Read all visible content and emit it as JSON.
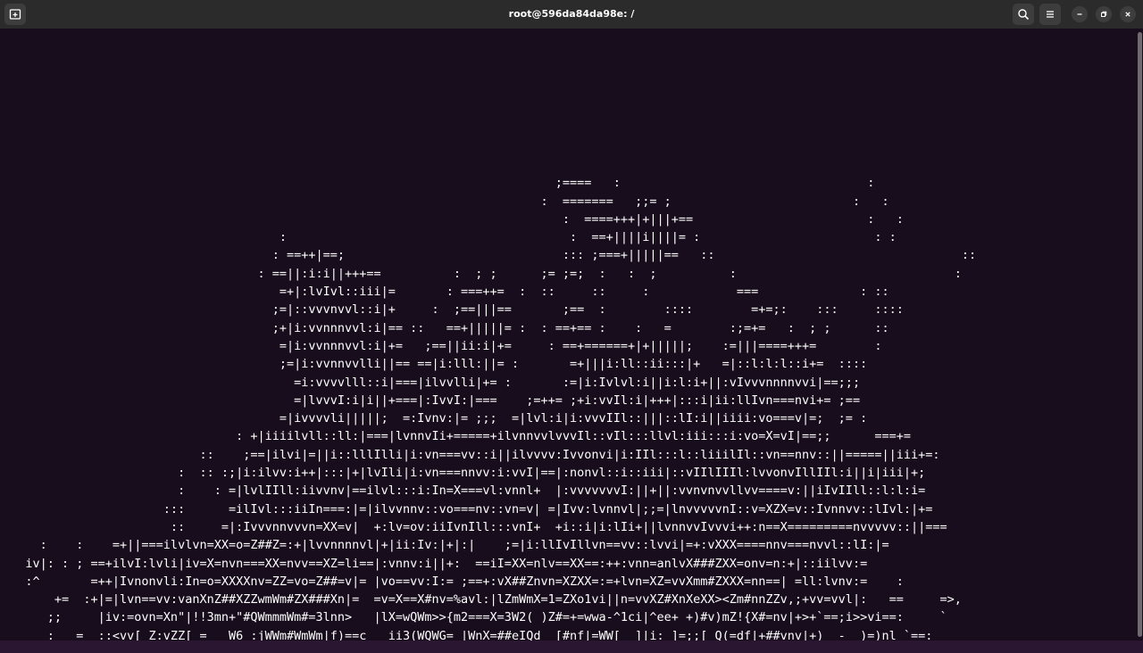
{
  "window": {
    "title": "root@596da84da98e: /",
    "icons": {
      "new_tab": "new-tab-icon",
      "search": "search-icon",
      "menu": "hamburger-menu-icon",
      "minimize": "minimize-icon",
      "restore": "restore-icon",
      "close": "close-icon"
    }
  },
  "colors": {
    "titlebar": "#2b2b2b",
    "terminal_bg": "#180d1d",
    "text": "#ffffff"
  },
  "terminal": {
    "lines": [
      "",
      "                                                                            ;====   :                                  :",
      "                                                                          :  =======   ;;= ;                         :   :",
      "                                                                             :  ====+++|+|||+==                        :   :",
      "                                      :                                       :  ==+||||i||||= :                        : :",
      "                                     : ==++|==;                              ::: ;===+|||||==   ::                                  ::",
      "                                   : ==||:i:i||+++==          :  ; ;      ;= ;=;  :   :  ;          :                              :",
      "                                      =+|:lvIvl::iii|=       : ===++=  :  ::     ::     :            ===              : ::",
      "                                     ;=|::vvvnvvl::i|+     :  ;==|||==       ;==  :        ::::        =+=;:    :::     ::::",
      "                                     ;+|i:vvnnnvvl:i|== ::   ==+|||||= :  : ==+== :    :   =        :;=+=   :  ; ;      ::",
      "                                      =|i:vvnnnvvl:i|+=   ;==||ii:i|+=     : ==+======+|+|||||;    :=|||====+++=        :",
      "                                      ;=|i:vvnnvvlli||== ==|i:lll:||= :       =+|||i:ll::ii:::|+   =|::l:l:l::i+=  ::::",
      "                                        =i:vvvvlll::i|===|ilvvlli|+= :       :=|i:Ivlvl:i||i:l:i+||:vIvvvnnnnvvi|==;;;",
      "                                        =|lvvvI:i|i||+===|:IvvI:|===    ;=++= ;+i:vvIl:i|+++|:::i|ii:llIvn===nvi+= ;==",
      "                                      =|ivvvvli|||||;  =:Ivnv:|= ;;;  =|lvl:i|i:vvvIIl::|||::lI:i||iiii:vo===v|=;  ;= :",
      "                                : +|iiiilvll::ll:|===|lvnnvIi+=====+ilvnnvvlvvvIl::vIl:::llvl:iii:::i:vo=X=vI|==;;      ===+=",
      "                           ::    ;==|ilvi|=||i::lllIlli|i:vn===vv::i||ilvvvv:Ivvonvi|i:IIl:::l::liiilIl::vn==nnv::||=====||iii+=:",
      "                        :  :: :;|i:ilvv:i++|:::|+|lvIli|i:vn===nnvv:i:vvI|==|:nonvl::i::iii|::vIIlIIIl:lvvonvIllIIl:i||i|iii|+;",
      "                        :    : =|lvlIIll:iivvnv|==ilvl:::i:In=X===vl:vnnl+  |:vvvvvvvI:||+||:vvnvnvvllvv====v:||iIvIIll::l:l:i=",
      "                      :::      =ilIvl:::iiIn===:|=|ilvvnnv::vo===nv::vn=v| =|Ivv:lvnnvl|;;=|lnvvvvvnI::v=XZX=v::Ivnnvv::lIvl:|+=",
      "                       ::     =|:Ivvvnnvvvn=XX=v|  +:lv=ov:iiIvnIll:::vnI+  +i::i|i:lIi+||lvnnvvIvvvi++:n==X=========nvvvvv::||===",
      "     :    :    =+||===ilvlvn=XX=o=Z##Z=:+|lvvnnnnvl|+|ii:Iv:|+|:|    ;=|i:llIvIllvn==vv::lvvi|=+:vXXX====nnv===nvvl::lI:|=",
      "   iv|: : ; ==+ilvI:lvli|iv=X=nvn===XX=nvv==XZ=li==|:vnnv:i||+:  ==iI=XX=nlv==XX==:++:vnn=anlvX###ZXX=onv=n:+|::iilvv:=",
      "   :^       =++|Ivnonvli:In=o=XXXXnv=ZZ=vo=Z##=v|= |vo==vv:I:= ;==+:vX##Znvn=XZXX=:=+lvn=XZ=vvXmm#ZXXX=nn==| =ll:lvnv:=    :",
      "       +=  :+|=|lvn==vv:vanXnZ##XZZwmWm#ZX###Xn|=  =v=X==X#nv=%avl:|lZmWmX=1=ZXo1vi||n=vvXZ#XnXeXX><Zm#nnZZv,;+vv=vvl|:   ==     =>,",
      "      ;;     |iv:=ovn=Xn\"|!!3mn+\"#QWmmmWm#=3lnn>   |lX=wQWm>>{m2===X=3W2( )Z#=+=wwa-^1ci|^ee+ +)#v)mZ!{X#=nv|+>+`==;i>>vi==:     `",
      "      :   =  ::<vv[ Z:vZZ[ =  _W6 :jWWm#WmWm|f)==c   ii3(WQWG= |WnX=##eIQd  [#nf|=WW[  ]|i: ]=;;[ Q(=df|+##vnv|+)  -  )=)nl `==:",
      "         ``'--``\"--\"^\"^^\"'-~ \"~`^'\"|~!|`~\"^\"`- \"\"- -|-``~'~\"'\"`-` ^\"^\"|\"-\"'\"\"|\"\"^'`~ -'\"\"``|\"~ ``--`-|~^^|-\"`'` \"\"'`` \"'--` - -"
    ]
  }
}
